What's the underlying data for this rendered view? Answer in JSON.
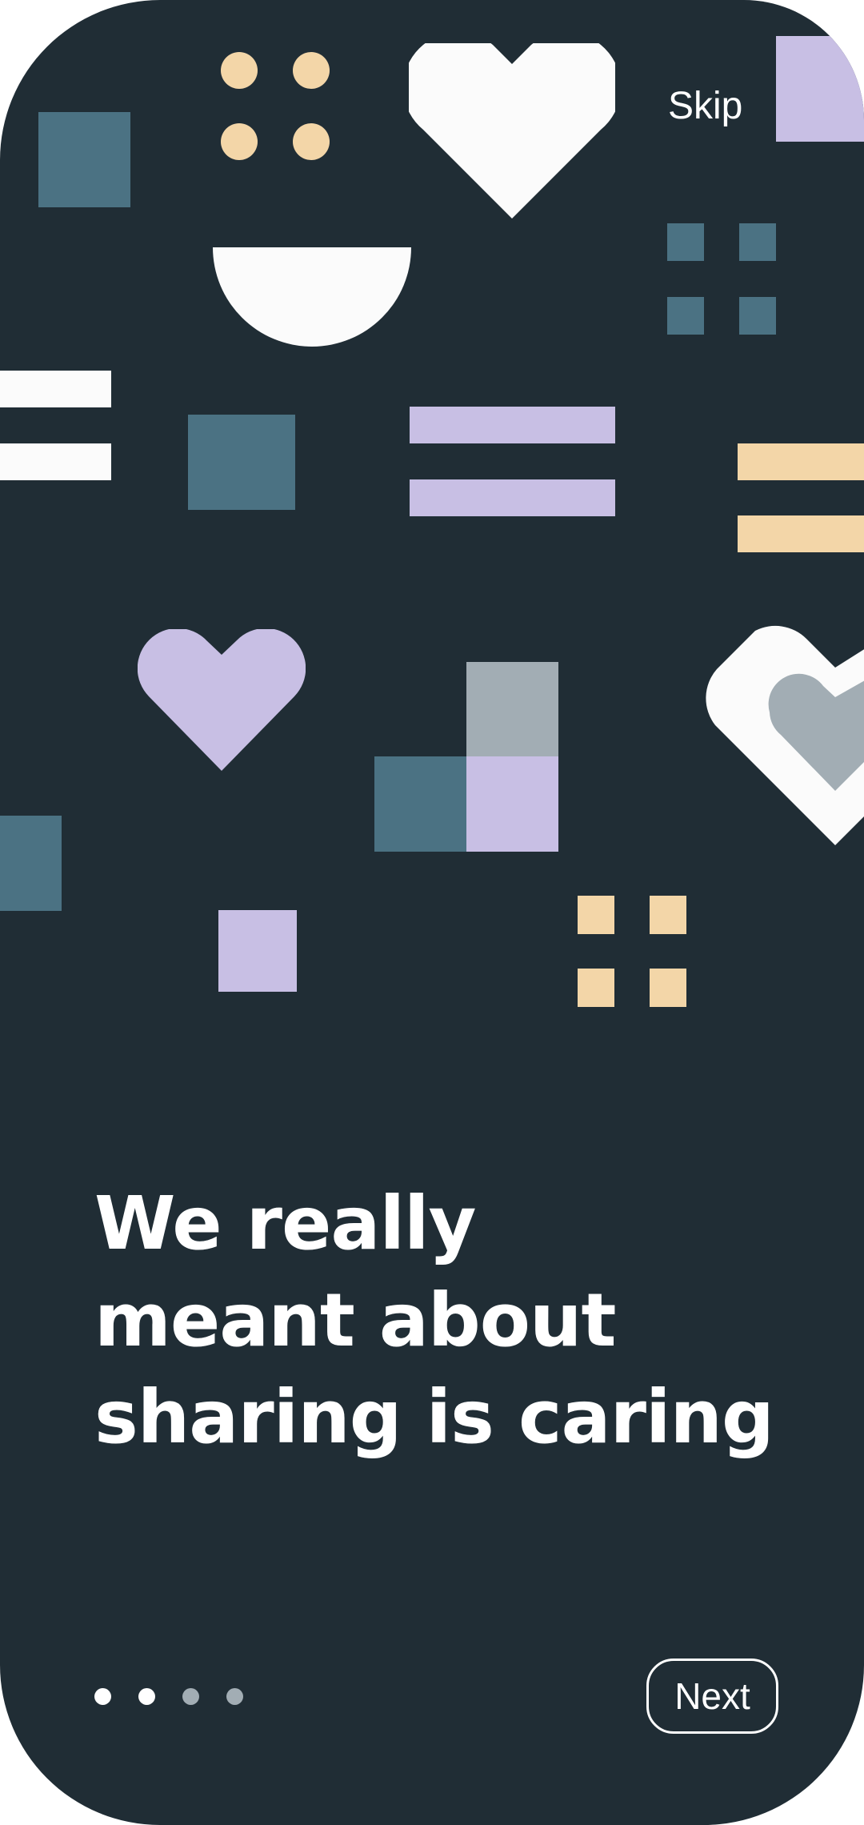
{
  "colors": {
    "background": "#202d35",
    "teal": "#4b7283",
    "lavender": "#c8bfe4",
    "peach": "#f3d6a8",
    "white": "#fbfbfb",
    "gray": "#a2adb4",
    "dot_active": "#ffffff",
    "dot_inactive": "#a2adb4"
  },
  "header": {
    "skip_label": "Skip"
  },
  "onboarding": {
    "headline_lines": [
      "We really",
      "meant about",
      "sharing is caring"
    ]
  },
  "pagination": {
    "total": 4,
    "active": [
      true,
      true,
      false,
      false
    ]
  },
  "footer": {
    "next_label": "Next"
  }
}
